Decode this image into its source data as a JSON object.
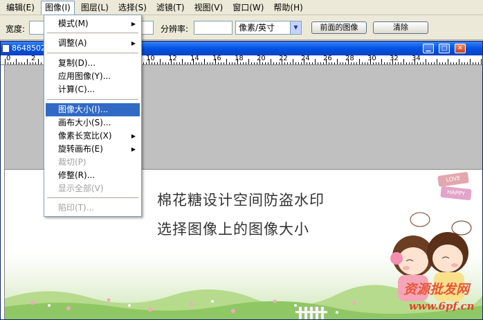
{
  "menubar": {
    "items": [
      "编辑(E)",
      "图像(I)",
      "图层(L)",
      "选择(S)",
      "滤镜(T)",
      "视图(V)",
      "窗口(W)",
      "帮助(H)"
    ]
  },
  "options": {
    "width_label": "宽度:",
    "resolution_label": "分辨率:",
    "unit_value": "像素/英寸",
    "front_image_button": "前面的图像",
    "clear_button": "清除"
  },
  "document": {
    "title": "8648502_",
    "ruler_numbers": [
      "0",
      "2",
      "10",
      "12",
      "14",
      "16",
      "18",
      "20",
      "22",
      "24",
      "26",
      "28",
      "30",
      "32",
      "34"
    ]
  },
  "canvas": {
    "line1": "棉花糖设计空间防盗水印",
    "line2": "选择图像上的图像大小",
    "sign_love": "LOVE",
    "sign_happy": "HAPPY",
    "watermark_cn": "资源批发网",
    "watermark_url": "www.6pf.cn"
  },
  "image_menu": {
    "items": [
      {
        "label": "模式(M)",
        "submenu": true,
        "disabled": false,
        "selected": false
      },
      {
        "label": "调整(A)",
        "submenu": true,
        "disabled": false,
        "selected": false
      },
      {
        "label": "复制(D)...",
        "submenu": false,
        "disabled": false,
        "selected": false
      },
      {
        "label": "应用图像(Y)...",
        "submenu": false,
        "disabled": false,
        "selected": false
      },
      {
        "label": "计算(C)...",
        "submenu": false,
        "disabled": false,
        "selected": false
      },
      {
        "label": "图像大小(I)...",
        "submenu": false,
        "disabled": false,
        "selected": true
      },
      {
        "label": "画布大小(S)...",
        "submenu": false,
        "disabled": false,
        "selected": false
      },
      {
        "label": "像素长宽比(X)",
        "submenu": true,
        "disabled": false,
        "selected": false
      },
      {
        "label": "旋转画布(E)",
        "submenu": true,
        "disabled": false,
        "selected": false
      },
      {
        "label": "裁切(P)",
        "submenu": false,
        "disabled": true,
        "selected": false
      },
      {
        "label": "修整(R)...",
        "submenu": false,
        "disabled": false,
        "selected": false
      },
      {
        "label": "显示全部(V)",
        "submenu": false,
        "disabled": true,
        "selected": false
      },
      {
        "label": "陷印(T)...",
        "submenu": false,
        "disabled": true,
        "selected": false
      }
    ]
  },
  "colors": {
    "selection": "#316ac5",
    "title_bar": "#0054e3",
    "watermark": "#e8563a"
  },
  "icons": {
    "submenu_arrow": "triangle-right-icon",
    "dropdown_arrow": "chevron-down-icon",
    "minimize": "minimize-icon",
    "maximize": "maximize-icon",
    "close": "close-icon",
    "document": "document-icon"
  }
}
